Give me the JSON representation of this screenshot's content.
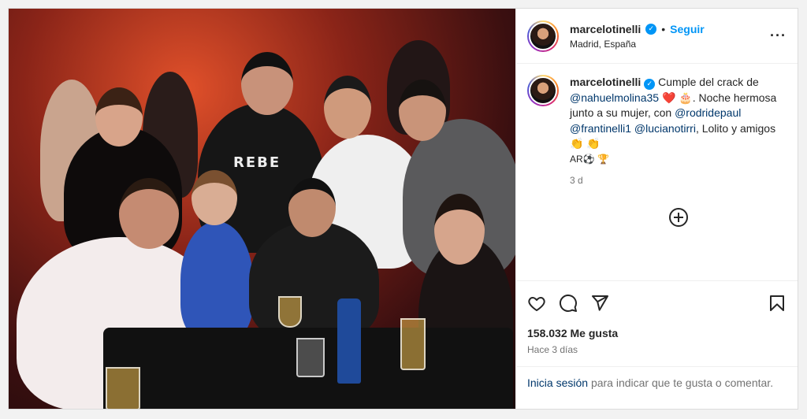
{
  "header": {
    "username": "marcelotinelli",
    "verified_mark": "✓",
    "dot": "•",
    "follow_label": "Seguir",
    "location": "Madrid, España",
    "more_label": "···"
  },
  "caption": {
    "username": "marcelotinelli",
    "text_1": "Cumple del crack de",
    "mention_1": "@nahuelmolina35",
    "heart": "❤️",
    "cake": "🎂",
    "text_2": ". Noche hermosa junto a su mujer, con",
    "mention_2": "@rodridepaul",
    "mention_3": "@frantinelli1",
    "mention_4": "@lucianotirri",
    "text_3": ", Lolito y amigos",
    "claps": "👏 👏",
    "country": "AR⚽ 🏆",
    "time": "3 d"
  },
  "photo": {
    "shirt_text": "REBE"
  },
  "actions": {
    "likes": "158.032 Me gusta",
    "posted": "Hace 3 días"
  },
  "login": {
    "link": "Inicia sesión",
    "rest": "para indicar que te gusta o comentar."
  },
  "icons": [
    "heart-icon",
    "comment-icon",
    "share-icon",
    "bookmark-icon",
    "add-comment-icon",
    "more-icon",
    "verified-icon"
  ]
}
